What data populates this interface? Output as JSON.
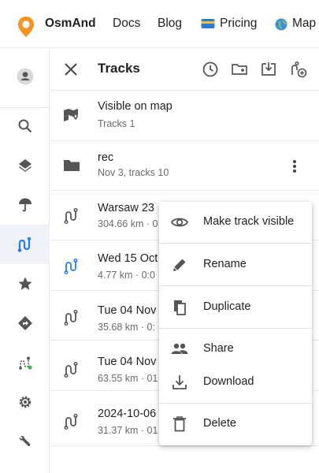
{
  "nav": {
    "brand": "OsmAnd",
    "links": [
      "Docs",
      "Blog",
      "Pricing",
      "Map"
    ]
  },
  "rail": {
    "items": [
      "account-icon",
      "search-icon",
      "layers-icon",
      "weather-icon",
      "tracks-icon",
      "favorites-icon",
      "navigation-icon",
      "route-planner-icon",
      "settings-icon",
      "tools-icon"
    ],
    "active": "tracks-icon"
  },
  "panel": {
    "title": "Tracks"
  },
  "list": {
    "visible": {
      "title": "Visible on map",
      "sub": "Tracks 1"
    },
    "folder": {
      "title": "rec",
      "sub": "Nov 3, tracks 10"
    },
    "tracks": [
      {
        "title": "Warsaw 23",
        "sub": "304.66 km · 0",
        "active": false
      },
      {
        "title": "Wed 15 Oct",
        "sub": "4.77 km · 0:0",
        "active": true
      },
      {
        "title": "Tue 04 Nov",
        "sub": "35.68 km · 0:",
        "active": false
      },
      {
        "title": "Tue 04 Nov",
        "sub": "63.55 km · 01",
        "active": false
      },
      {
        "title": "2024-10-06",
        "sub": "31.37 km · 01",
        "active": false
      }
    ]
  },
  "menu": {
    "items": [
      {
        "label": "Make track visible",
        "icon": "eye-icon"
      },
      {
        "label": "Rename",
        "icon": "pencil-icon"
      },
      {
        "label": "Duplicate",
        "icon": "duplicate-icon"
      },
      {
        "label": "Share",
        "icon": "share-people-icon"
      },
      {
        "label": "Download",
        "icon": "download-icon"
      },
      {
        "label": "Delete",
        "icon": "trash-icon"
      }
    ]
  },
  "colors": {
    "brand_orange": "#f7931e",
    "accent_blue": "#237bff",
    "icon_gray": "#555555",
    "active_bg": "#f0f2f8"
  }
}
